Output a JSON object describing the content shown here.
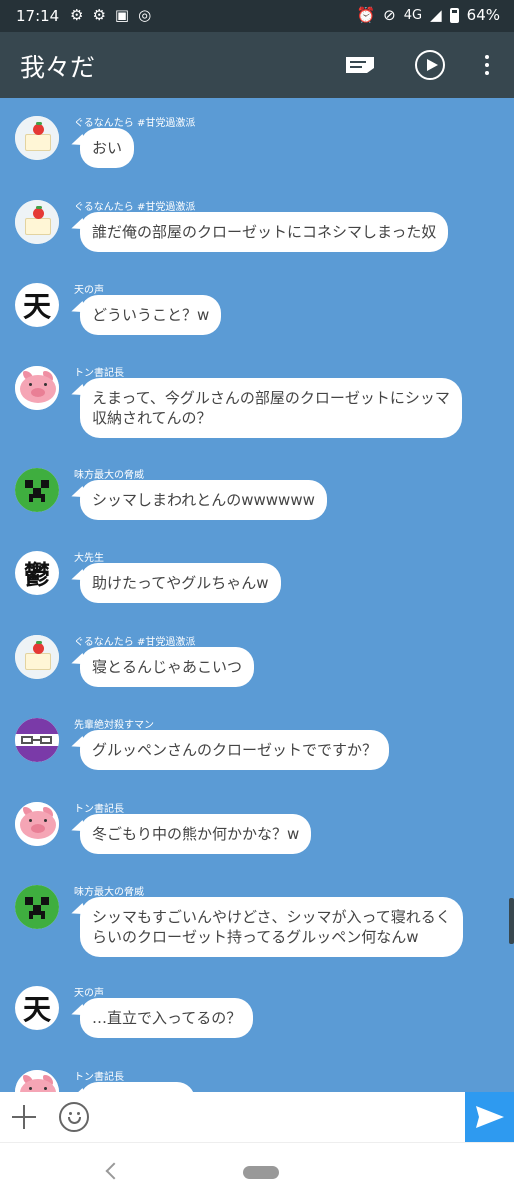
{
  "status": {
    "time": "17:14",
    "network": "4G",
    "battery": "64%"
  },
  "header": {
    "title": "我々だ"
  },
  "messages": [
    {
      "sender": "ぐるなんたら #甘党過激派",
      "text": "おい",
      "avatar": "cake"
    },
    {
      "sender": "ぐるなんたら #甘党過激派",
      "text": "誰だ俺の部屋のクローゼットにコネシマしまった奴",
      "avatar": "cake"
    },
    {
      "sender": "天の声",
      "text": "どういうこと？w",
      "avatar": "kanji-ten",
      "avatar_text": "天"
    },
    {
      "sender": "トン書記長",
      "line1": "えまって、今グルさんの部屋のクローゼットにシッマ",
      "line2": "収納されてんの？",
      "avatar": "pig"
    },
    {
      "sender": "味方最大の脅威",
      "text": "シッマしまわれとんのwwwwww",
      "avatar": "creeper"
    },
    {
      "sender": "大先生",
      "text": "助けたってやグルちゃんw",
      "avatar": "kanji-utsu",
      "avatar_text": "鬱"
    },
    {
      "sender": "ぐるなんたら #甘党過激派",
      "text": "寝とるんじゃあこいつ",
      "avatar": "cake"
    },
    {
      "sender": "先輩絶対殺すマン",
      "text": "グルッペンさんのクローゼットでですか？",
      "avatar": "mask"
    },
    {
      "sender": "トン書記長",
      "text": "冬ごもり中の熊か何かかな？w",
      "avatar": "pig"
    },
    {
      "sender": "味方最大の脅威",
      "line1": "シッマもすごいんやけどさ、シッマが入って寝れるく",
      "line2": "らいのクローゼット持ってるグルッペン何なんw",
      "avatar": "creeper"
    },
    {
      "sender": "天の声",
      "text": "…直立で入ってるの？",
      "avatar": "kanji-ten",
      "avatar_text": "天"
    },
    {
      "sender": "トン書記長",
      "text": "",
      "avatar": "pig"
    }
  ],
  "input": {
    "placeholder": "",
    "value": ""
  },
  "colors": {
    "chat_bg": "#5b9bd5",
    "appbar": "#37474f",
    "statusbar": "#263238",
    "send": "#2e9af0"
  }
}
